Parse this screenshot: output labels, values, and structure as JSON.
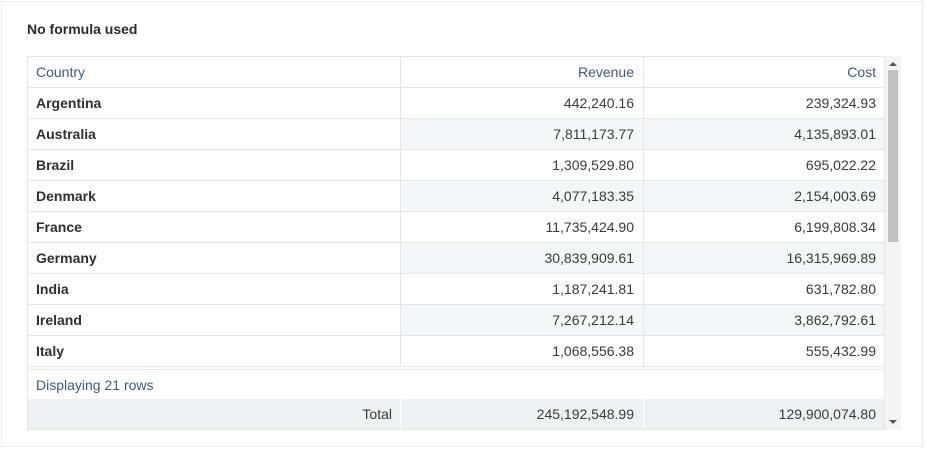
{
  "title": "No formula used",
  "columns": [
    "Country",
    "Revenue",
    "Cost"
  ],
  "rows": [
    [
      "Argentina",
      "442,240.16",
      "239,324.93"
    ],
    [
      "Australia",
      "7,811,173.77",
      "4,135,893.01"
    ],
    [
      "Brazil",
      "1,309,529.80",
      "695,022.22"
    ],
    [
      "Denmark",
      "4,077,183.35",
      "2,154,003.69"
    ],
    [
      "France",
      "11,735,424.90",
      "6,199,808.34"
    ],
    [
      "Germany",
      "30,839,909.61",
      "16,315,969.89"
    ],
    [
      "India",
      "1,187,241.81",
      "631,782.80"
    ],
    [
      "Ireland",
      "7,267,212.14",
      "3,862,792.61"
    ],
    [
      "Italy",
      "1,068,556.38",
      "555,432.99"
    ]
  ],
  "status": "Displaying 21 rows",
  "total": {
    "label": "Total",
    "revenue": "245,192,548.99",
    "cost": "129,900,074.80"
  }
}
